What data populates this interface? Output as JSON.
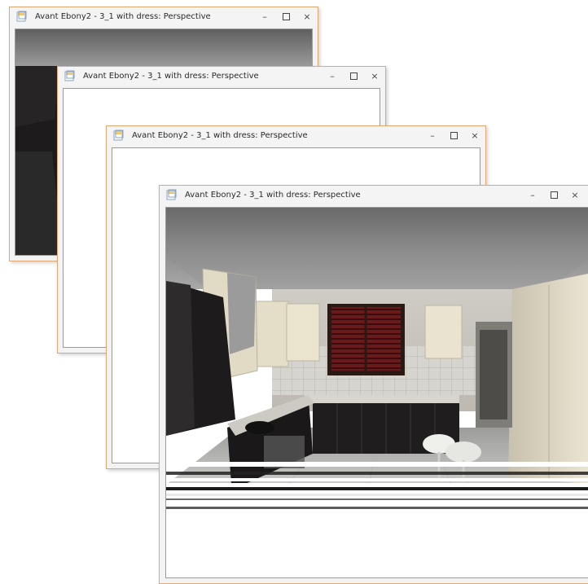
{
  "windows": [
    {
      "title": "Avant Ebony2 - 3_1 with dress: Perspective",
      "minimize": "–",
      "close": "×"
    },
    {
      "title": "Avant Ebony2 - 3_1 with dress: Perspective",
      "minimize": "–",
      "close": "×"
    },
    {
      "title": "Avant Ebony2 - 3_1 with dress: Perspective",
      "minimize": "–",
      "close": "×"
    },
    {
      "title": "Avant Ebony2 - 3_1 with dress: Perspective",
      "minimize": "–",
      "close": "×"
    }
  ],
  "icons": {
    "app": "app-document-icon",
    "minimize": "minimize-icon",
    "maximize": "maximize-icon",
    "close": "close-icon"
  },
  "colors": {
    "window_border": "#e0a875",
    "titlebar": "#f4f4f4",
    "ceiling": "#7a7a7a",
    "dark_cabinet": "#1e1c1c",
    "cream_cabinet": "#e7e1ca"
  }
}
